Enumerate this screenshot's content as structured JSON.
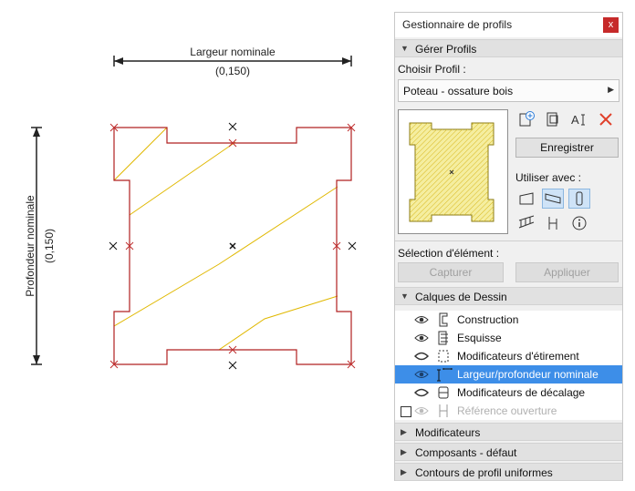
{
  "drawing": {
    "width_label": "Largeur nominale",
    "width_value": "(0,150)",
    "depth_label": "Profondeur nominale",
    "depth_value": "(0,150)"
  },
  "panel": {
    "title": "Gestionnaire de profils",
    "close": "x",
    "manage_section": "Gérer Profils",
    "choose_label": "Choisir Profil :",
    "profile_value": "Poteau - ossature bois",
    "save_label": "Enregistrer",
    "use_with_label": "Utiliser avec :",
    "selection_label": "Sélection d'élément :",
    "capture_label": "Capturer",
    "apply_label": "Appliquer",
    "layers_section": "Calques de Dessin",
    "layers": [
      {
        "name": "Construction",
        "icon": "construction-layer-icon"
      },
      {
        "name": "Esquisse",
        "icon": "sketch-layer-icon"
      },
      {
        "name": "Modificateurs d'étirement",
        "icon": "stretch-modifier-icon"
      },
      {
        "name": "Largeur/profondeur nominale",
        "icon": "nominal-size-icon"
      },
      {
        "name": "Modificateurs de décalage",
        "icon": "offset-modifier-icon"
      },
      {
        "name": "Référence ouverture",
        "icon": "opening-reference-icon"
      }
    ],
    "modifiers_section": "Modificateurs",
    "components_section": "Composants - défaut",
    "contours_section": "Contours de profil uniformes"
  },
  "colors": {
    "profile_outline": "#b02020",
    "fill_lines": "#e0b800",
    "selection": "#3d8ee8"
  }
}
